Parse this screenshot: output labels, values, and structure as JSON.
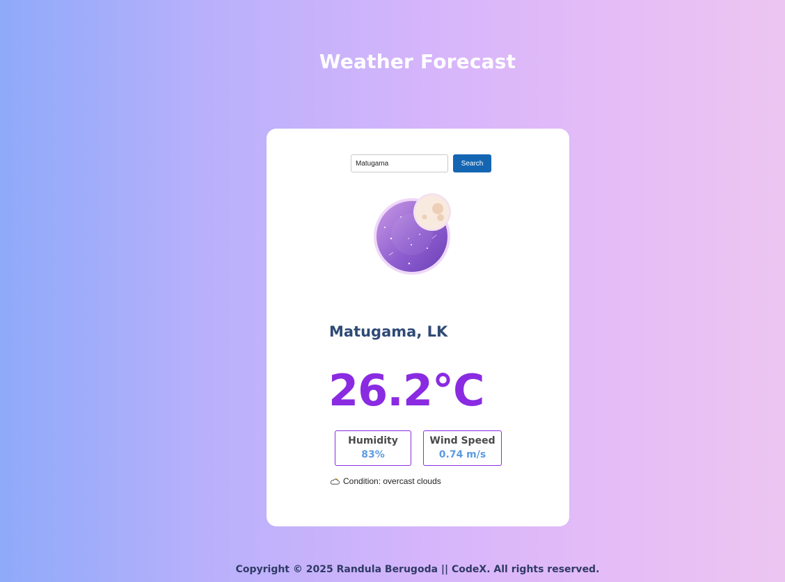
{
  "header": {
    "title": "Weather Forecast"
  },
  "search": {
    "value": "Matugama",
    "button_label": "Search"
  },
  "weather": {
    "illustration_icon": "night-moon-icon",
    "location": "Matugama, LK",
    "temperature": "26.2°C",
    "humidity_label": "Humidity",
    "humidity_value": "83%",
    "wind_label": "Wind Speed",
    "wind_value": "0.74 m/s",
    "condition_icon": "cloud-sun-icon",
    "condition_text": "Condition: overcast clouds"
  },
  "footer": {
    "text": "Copyright © 2025 Randula Berugoda || CodeX. All rights reserved."
  },
  "colors": {
    "accent": "#8a2be2",
    "button": "#1466b3",
    "city": "#2f4a75",
    "stat_value": "#5b9be0"
  }
}
